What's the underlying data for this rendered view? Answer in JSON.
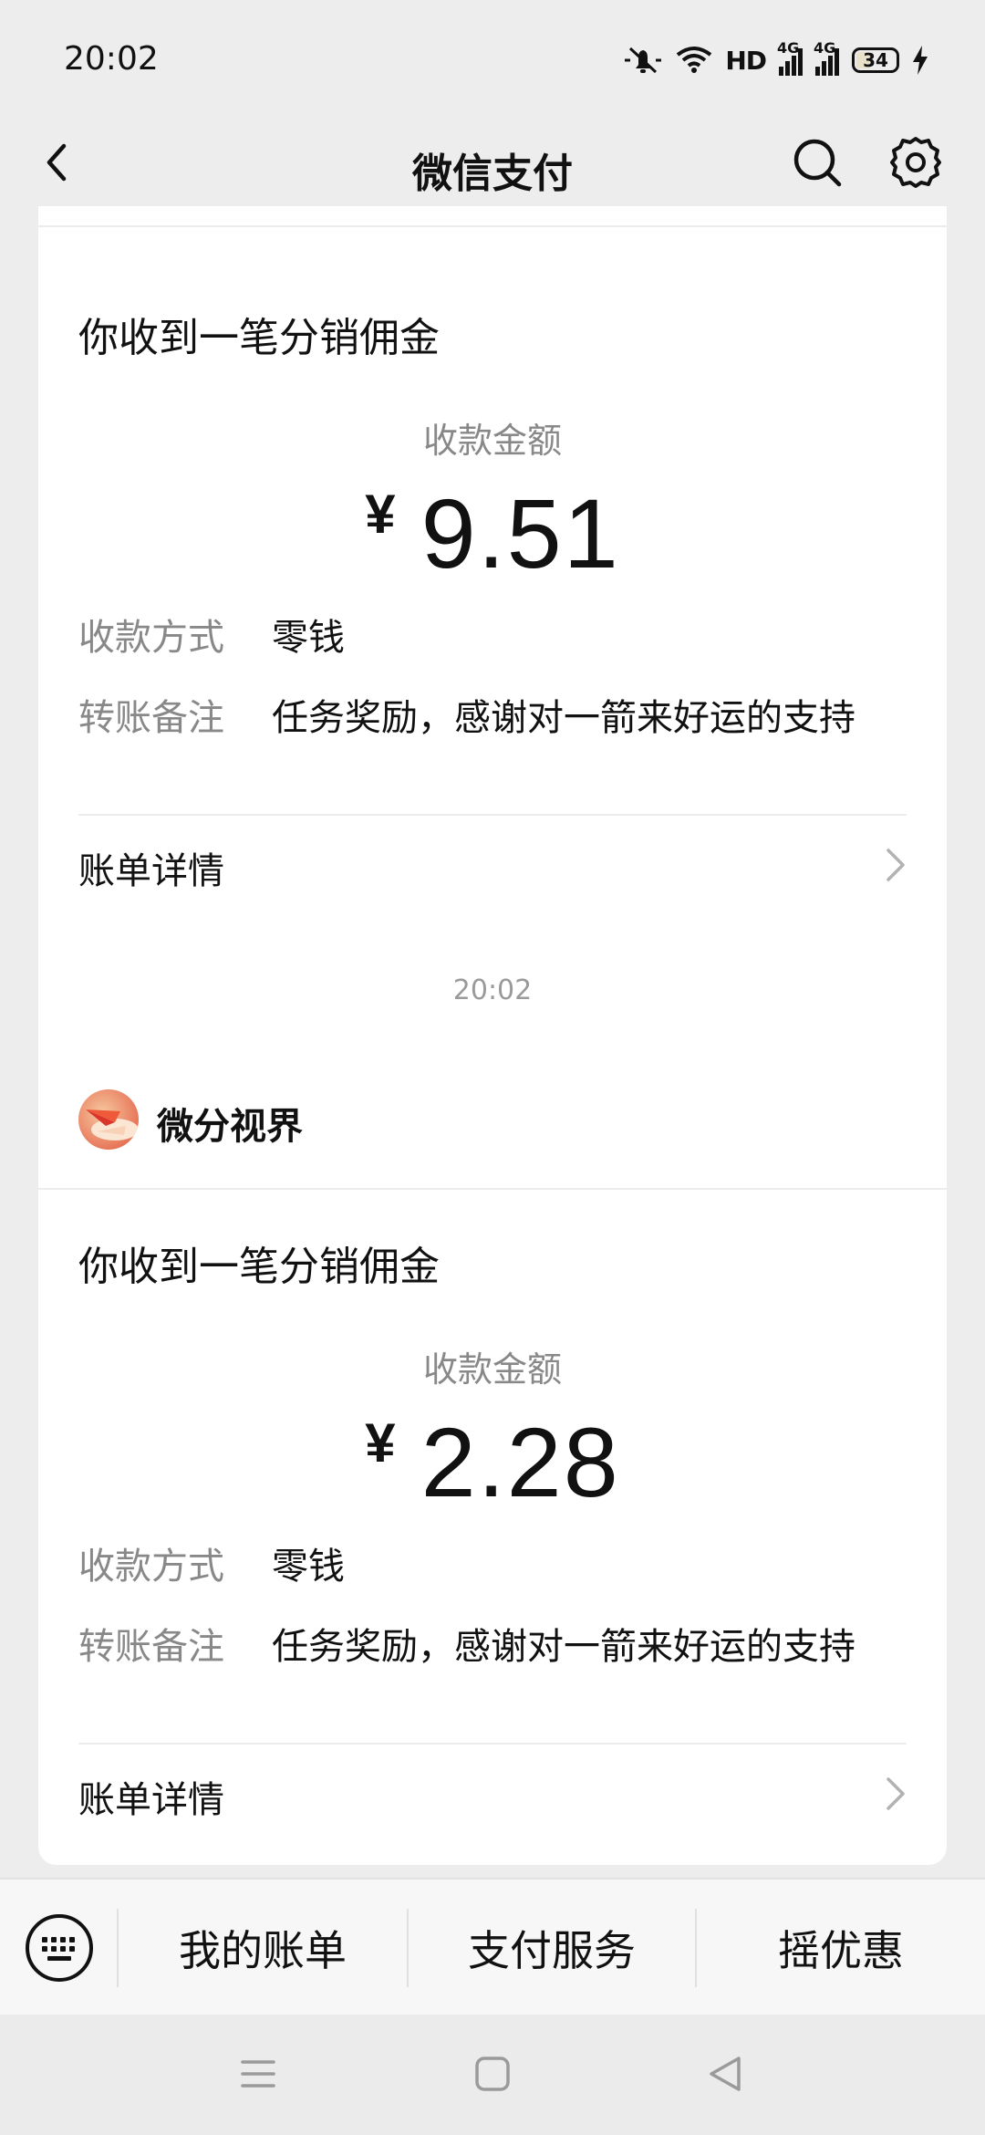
{
  "status_bar": {
    "time": "20:02",
    "hd_label": "HD",
    "network_1": "4G",
    "network_2": "4G",
    "battery": "34"
  },
  "nav": {
    "title": "微信支付"
  },
  "cards": [
    {
      "notice_title": "你收到一笔分销佣金",
      "amount_label": "收款金额",
      "currency": "¥",
      "amount": "9.51",
      "method_key": "收款方式",
      "method_value": "零钱",
      "note_key": "转账备注",
      "note_value": "任务奖励，感谢对一箭来好运的支持",
      "detail_label": "账单详情"
    },
    {
      "merchant": "微分视界",
      "notice_title": "你收到一笔分销佣金",
      "amount_label": "收款金额",
      "currency": "¥",
      "amount": "2.28",
      "method_key": "收款方式",
      "method_value": "零钱",
      "note_key": "转账备注",
      "note_value": "任务奖励，感谢对一箭来好运的支持",
      "detail_label": "账单详情"
    }
  ],
  "timestamp": "20:02",
  "bottom_menu": {
    "items": [
      "我的账单",
      "支付服务",
      "摇优惠"
    ]
  },
  "icons": {
    "back": "back-arrow-icon",
    "search": "search-icon",
    "settings": "gear-icon",
    "keyboard": "keyboard-icon",
    "chevron": "chevron-right-icon"
  }
}
